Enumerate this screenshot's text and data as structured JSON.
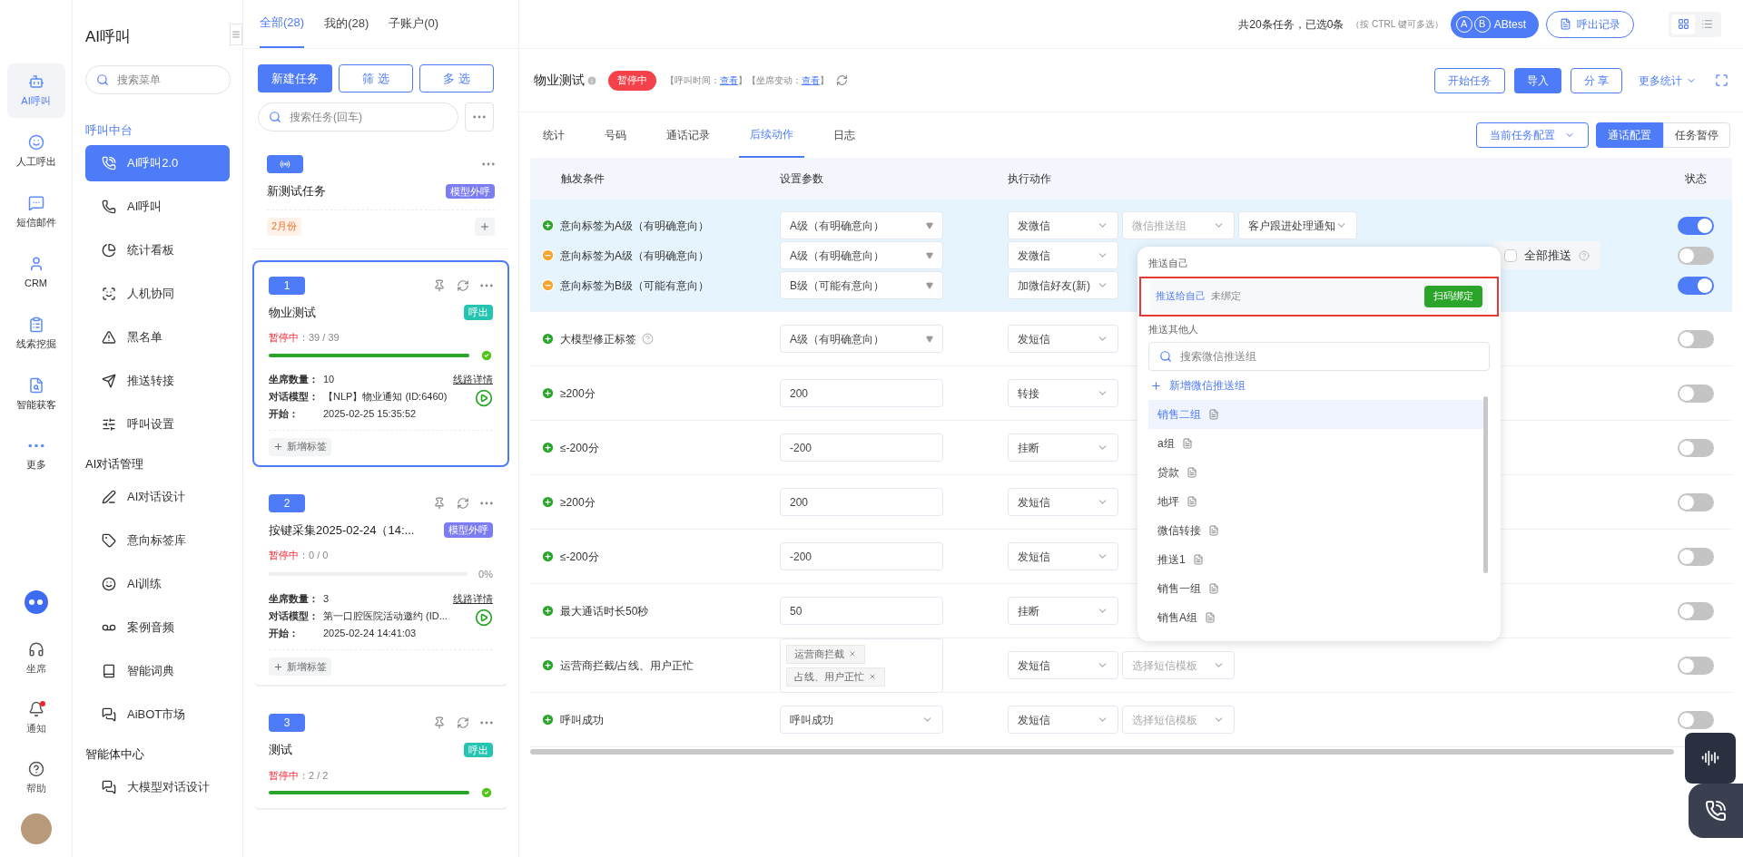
{
  "rail": {
    "items": [
      {
        "label": "AI呼叫",
        "selected": true
      },
      {
        "label": "人工呼出",
        "selected": false
      },
      {
        "label": "短信邮件",
        "selected": false
      },
      {
        "label": "CRM",
        "selected": false
      },
      {
        "label": "线索挖掘",
        "selected": false
      },
      {
        "label": "智能获客",
        "selected": false
      },
      {
        "label": "更多",
        "selected": false
      }
    ],
    "bottom": [
      {
        "label": "坐席",
        "dot": false
      },
      {
        "label": "通知",
        "dot": true
      },
      {
        "label": "帮助",
        "dot": false
      }
    ]
  },
  "menu": {
    "title": "AI呼叫",
    "search": {
      "placeholder": "搜索菜单"
    },
    "sections": [
      {
        "title": "呼叫中台",
        "items": [
          {
            "label": "AI呼叫2.0",
            "selected": true
          },
          {
            "label": "AI呼叫",
            "selected": false
          },
          {
            "label": "统计看板",
            "selected": false
          },
          {
            "label": "人机协同",
            "selected": false
          },
          {
            "label": "黑名单",
            "selected": false
          },
          {
            "label": "推送转接",
            "selected": false
          },
          {
            "label": "呼叫设置",
            "selected": false
          }
        ]
      },
      {
        "title": "AI对话管理",
        "items": [
          {
            "label": "AI对话设计",
            "selected": false
          },
          {
            "label": "意向标签库",
            "selected": false
          },
          {
            "label": "AI训练",
            "selected": false
          },
          {
            "label": "案例音频",
            "selected": false
          },
          {
            "label": "智能词典",
            "selected": false
          },
          {
            "label": "AiBOT市场",
            "selected": false
          }
        ]
      },
      {
        "title": "智能体中心",
        "items": [
          {
            "label": "大模型对话设计",
            "selected": false
          }
        ]
      }
    ]
  },
  "task_list": {
    "tabs": [
      {
        "label": "全部(28)",
        "selected": true
      },
      {
        "label": "我的(28)",
        "selected": false
      },
      {
        "label": "子账户(0)",
        "selected": false
      }
    ],
    "buttons": [
      {
        "label": "新建任务",
        "kind": "primary"
      },
      {
        "label": "筛 选",
        "kind": "outline"
      },
      {
        "label": "多 选",
        "kind": "outline"
      }
    ],
    "search": {
      "placeholder": "搜索任务(回车)"
    },
    "group": {
      "name": "新测试任务",
      "tag": "模型外呼",
      "month": "2月份"
    },
    "tasks": [
      {
        "index": "1",
        "name": "物业测试",
        "tag": {
          "label": "呼出",
          "kind": "outbound"
        },
        "selected": true,
        "status": "暂停中",
        "progress": "：39 / 39",
        "level": 1,
        "done": true,
        "fields": [
          {
            "label": "坐席数量：",
            "value": "10",
            "link": "线路详情"
          },
          {
            "label": "对话模型：",
            "value": "【NLP】物业通知 (ID:6460)"
          },
          {
            "label": "开始：",
            "value": "2025-02-25 15:35:52"
          }
        ],
        "add_tag": "新增标签"
      },
      {
        "index": "2",
        "name": "按键采集2025-02-24（14:...",
        "tag": {
          "label": "模型外呼",
          "kind": "model"
        },
        "selected": false,
        "status": "暂停中",
        "progress": "：0 / 0",
        "level": 0,
        "done": false,
        "percent": "0%",
        "fields": [
          {
            "label": "坐席数量：",
            "value": "3",
            "link": "线路详情"
          },
          {
            "label": "对话模型：",
            "value": "第一口腔医院活动邀约 (ID..."
          },
          {
            "label": "开始：",
            "value": "2025-02-24 14:41:03"
          }
        ],
        "add_tag": "新增标签"
      },
      {
        "index": "3",
        "name": "测试",
        "tag": {
          "label": "呼出",
          "kind": "outbound"
        },
        "selected": false,
        "status": "暂停中",
        "progress": "：2 / 2",
        "level": 1,
        "done": true
      }
    ]
  },
  "top_bar": {
    "summary": "共20条任务，已选0条",
    "hint": "（按 CTRL 键可多选）",
    "account": "ABtest",
    "avatar_letters": [
      "A",
      "B"
    ],
    "record_button": "呼出记录",
    "views": [
      {
        "selected": true
      },
      {
        "selected": false
      }
    ]
  },
  "task_header": {
    "title": "物业测试",
    "status": "暂停中",
    "meta": [
      {
        "kind": "text",
        "text": "【呼叫时间："
      },
      {
        "kind": "link",
        "text": "查看"
      },
      {
        "kind": "text",
        "text": "】【坐席变动："
      },
      {
        "kind": "link",
        "text": "查看"
      },
      {
        "kind": "text",
        "text": "】"
      }
    ],
    "buttons": [
      {
        "label": "开始任务",
        "kind": "outline"
      },
      {
        "label": "导入",
        "kind": "primary"
      },
      {
        "label": "分 享",
        "kind": "outline"
      }
    ],
    "more": "更多统计"
  },
  "tabs": [
    {
      "label": "统计",
      "selected": false
    },
    {
      "label": "号码",
      "selected": false
    },
    {
      "label": "通话记录",
      "selected": false
    },
    {
      "label": "后续动作",
      "selected": true
    },
    {
      "label": "日志",
      "selected": false
    }
  ],
  "config": {
    "dropdown": "当前任务配置",
    "segments": [
      {
        "label": "通话配置",
        "selected": true
      },
      {
        "label": "任务暂停",
        "selected": false
      }
    ]
  },
  "table": {
    "columns": [
      "触发条件",
      "设置参数",
      "执行动作",
      "状态"
    ],
    "rows": [
      {
        "highlighted": true,
        "lines": [
          {
            "kind": "plus",
            "condition": "意向标签为A级（有明确意向）",
            "param": {
              "kind": "select",
              "value": "A级（有明确意向）"
            },
            "actions": [
              {
                "value": "发微信"
              },
              {
                "placeholder": "微信推送组"
              },
              {
                "value": "客户跟进处理通知"
              }
            ],
            "on": true
          },
          {
            "kind": "minus",
            "condition": "意向标签为A级（有明确意向）",
            "param": {
              "kind": "select",
              "value": "A级（有明确意向）"
            },
            "actions": [
              {
                "value": "发微信"
              }
            ],
            "push_all": {
              "label": "全部推送",
              "checked": false
            },
            "on": false
          },
          {
            "kind": "minus",
            "condition": "意向标签为B级（可能有意向）",
            "param": {
              "kind": "select",
              "value": "B级（可能有意向）"
            },
            "actions": [
              {
                "value": "加微信好友(新)"
              }
            ],
            "on": true
          }
        ]
      },
      {
        "highlighted": false,
        "lines": [
          {
            "kind": "plus",
            "condition": "大模型修正标签",
            "help": true,
            "param": {
              "kind": "select",
              "value": "A级（有明确意向）"
            },
            "actions": [
              {
                "value": "发短信"
              }
            ],
            "on": false
          }
        ]
      },
      {
        "highlighted": false,
        "lines": [
          {
            "kind": "plus",
            "condition": "≥200分",
            "param": {
              "kind": "input",
              "value": "200"
            },
            "actions": [
              {
                "value": "转接"
              }
            ],
            "on": false
          }
        ]
      },
      {
        "highlighted": false,
        "lines": [
          {
            "kind": "plus",
            "condition": "≤-200分",
            "param": {
              "kind": "input",
              "value": "-200"
            },
            "actions": [
              {
                "value": "挂断"
              }
            ],
            "on": false
          }
        ]
      },
      {
        "highlighted": false,
        "lines": [
          {
            "kind": "plus",
            "condition": "≥200分",
            "param": {
              "kind": "input",
              "value": "200"
            },
            "actions": [
              {
                "value": "发短信"
              }
            ],
            "on": false
          }
        ]
      },
      {
        "highlighted": false,
        "lines": [
          {
            "kind": "plus",
            "condition": "≤-200分",
            "param": {
              "kind": "input",
              "value": "-200"
            },
            "actions": [
              {
                "value": "发短信"
              }
            ],
            "on": false
          }
        ]
      },
      {
        "highlighted": false,
        "lines": [
          {
            "kind": "plus",
            "condition": "最大通话时长50秒",
            "param": {
              "kind": "input",
              "value": "50"
            },
            "actions": [
              {
                "value": "挂断"
              }
            ],
            "on": false
          }
        ]
      },
      {
        "highlighted": false,
        "lines": [
          {
            "kind": "plus",
            "condition": "运营商拦截/占线、用户正忙",
            "param": {
              "kind": "tags",
              "tags": [
                "运营商拦截",
                "占线、用户正忙"
              ]
            },
            "actions": [
              {
                "value": "发短信"
              },
              {
                "placeholder": "选择短信模板"
              }
            ],
            "on": false
          }
        ]
      },
      {
        "highlighted": false,
        "lines": [
          {
            "kind": "plus",
            "condition": "呼叫成功",
            "param": {
              "kind": "picker",
              "value": "呼叫成功"
            },
            "actions": [
              {
                "value": "发短信"
              },
              {
                "placeholder": "选择短信模板"
              }
            ],
            "on": false
          }
        ]
      }
    ]
  },
  "popup": {
    "self_title": "推送自己",
    "self_link": "推送给自己",
    "self_status": "未绑定",
    "bind_button": "扫码绑定",
    "marked": true,
    "others_title": "推送其他人",
    "search": {
      "placeholder": "搜索微信推送组"
    },
    "add_link": "新增微信推送组",
    "groups": [
      {
        "label": "销售二组",
        "selected": true
      },
      {
        "label": "a组",
        "selected": false
      },
      {
        "label": "贷款",
        "selected": false
      },
      {
        "label": "地坪",
        "selected": false
      },
      {
        "label": "微信转接",
        "selected": false
      },
      {
        "label": "推送1",
        "selected": false
      },
      {
        "label": "销售一组",
        "selected": false
      },
      {
        "label": "销售A组",
        "selected": false
      }
    ]
  }
}
